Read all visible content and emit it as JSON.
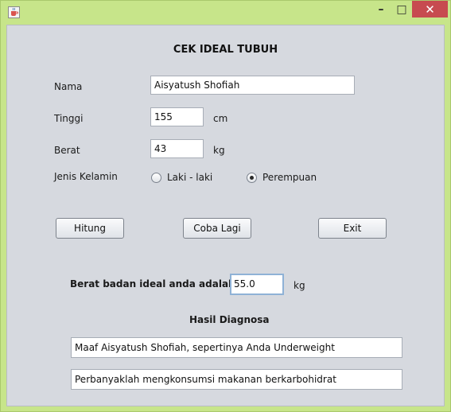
{
  "window": {
    "minimize_glyph": "–",
    "maximize_glyph": "□",
    "close_glyph": "✕",
    "icon": "java-cup-icon"
  },
  "form": {
    "title": "CEK IDEAL TUBUH",
    "nama_label": "Nama",
    "nama_value": "Aisyatush Shofiah",
    "tinggi_label": "Tinggi",
    "tinggi_value": "155",
    "tinggi_unit": "cm",
    "berat_label": "Berat",
    "berat_value": "43",
    "berat_unit": "kg",
    "gender_label": "Jenis Kelamin",
    "gender_options": [
      "Laki - laki",
      "Perempuan"
    ],
    "gender_selected": "Perempuan"
  },
  "buttons": {
    "hitung": "Hitung",
    "coba_lagi": "Coba Lagi",
    "exit": "Exit"
  },
  "result": {
    "ideal_label": "Berat badan ideal anda adalah",
    "ideal_value": "55.0",
    "ideal_unit": "kg",
    "diagnosa_title": "Hasil Diagnosa",
    "diagnosa_line1": "Maaf Aisyatush Shofiah, sepertinya Anda Underweight",
    "diagnosa_line2": "Perbanyaklah mengkonsumsi makanan berkarbohidrat"
  },
  "colors": {
    "frame": "#c7e58a",
    "panel": "#d6d9df",
    "close_button": "#c74b50"
  }
}
